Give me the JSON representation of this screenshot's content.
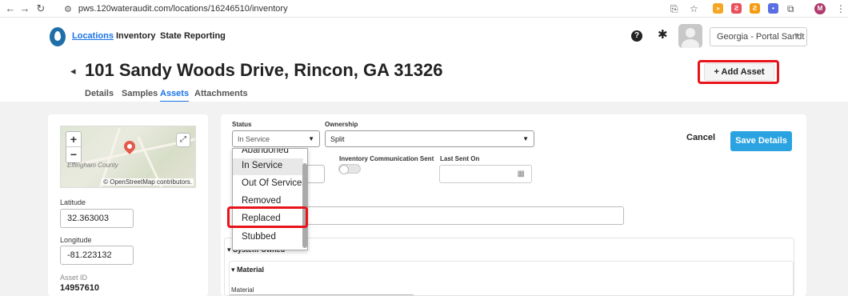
{
  "browser": {
    "url": "pws.120wateraudit.com/locations/16246510/inventory",
    "profile_initial": "M"
  },
  "nav": {
    "links": [
      "Locations",
      "Inventory",
      "State Reporting"
    ],
    "help_glyph": "?",
    "org_selector": "Georgia - Portal Sandt"
  },
  "page": {
    "title": "101 Sandy Woods Drive, Rincon, GA 31326",
    "add_asset_label": "+ Add Asset",
    "tabs": [
      "Details",
      "Samples",
      "Assets",
      "Attachments"
    ],
    "active_tab": "Assets"
  },
  "left": {
    "map_credit": "© OpenStreetMap contributors.",
    "map_place": "Effingham County",
    "latitude_label": "Latitude",
    "latitude_value": "32.363003",
    "longitude_label": "Longitude",
    "longitude_value": "-81.223132",
    "asset_id_label": "Asset ID",
    "asset_id_value": "14957610"
  },
  "form": {
    "status_label": "Status",
    "status_value": "In Service",
    "ownership_label": "Ownership",
    "ownership_value": "Split",
    "inventory_comm_label": "Inventory Communication Sent",
    "last_sent_label": "Last Sent On",
    "cancel_label": "Cancel",
    "save_label": "Save Details",
    "section_system_owned": "System-Owned",
    "section_material": "Material",
    "material_label": "Material"
  },
  "status_dropdown": {
    "options": [
      "Abandoned",
      "In Service",
      "Out Of Service",
      "Removed",
      "Replaced",
      "Stubbed"
    ],
    "hovered": "In Service",
    "highlighted": "Replaced"
  },
  "colors": {
    "accent": "#1a73e8",
    "save_button": "#2aa3e0",
    "highlight_box": "#e8131a",
    "brand": "#1f6fa8"
  }
}
